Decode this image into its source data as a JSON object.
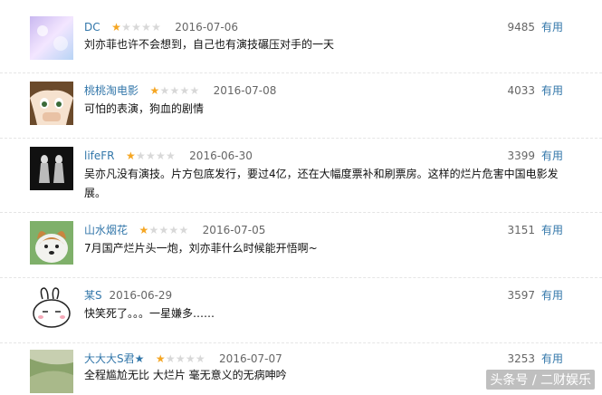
{
  "comments": [
    {
      "user": "DC",
      "rating": 1,
      "date": "2016-07-06",
      "votes": "9485",
      "useful": "有用",
      "text": "刘亦菲也许不会想到，自己也有演技碾压对手的一天"
    },
    {
      "user": "桃桃淘电影",
      "rating": 1,
      "date": "2016-07-08",
      "votes": "4033",
      "useful": "有用",
      "text": "可怕的表演，狗血的剧情"
    },
    {
      "user": "lifeFR",
      "rating": 1,
      "date": "2016-06-30",
      "votes": "3399",
      "useful": "有用",
      "text": "吴亦凡没有演技。片方包底发行，要过4亿，还在大幅度票补和刷票房。这样的烂片危害中国电影发展。"
    },
    {
      "user": "山水烟花",
      "rating": 1,
      "date": "2016-07-05",
      "votes": "3151",
      "useful": "有用",
      "text": "7月国产烂片头一炮，刘亦菲什么时候能开悟啊~"
    },
    {
      "user": "某S",
      "rating": 0,
      "date": "2016-06-29",
      "votes": "3597",
      "useful": "有用",
      "text": "快笑死了。。。一星嫌多……"
    },
    {
      "user": "大大大S君★",
      "rating": 1,
      "date": "2016-07-07",
      "votes": "3253",
      "useful": "有用",
      "text": "全程尴尬无比 大烂片 毫无意义的无病呻吟"
    }
  ],
  "watermark": "头条号 / 二财娱乐"
}
